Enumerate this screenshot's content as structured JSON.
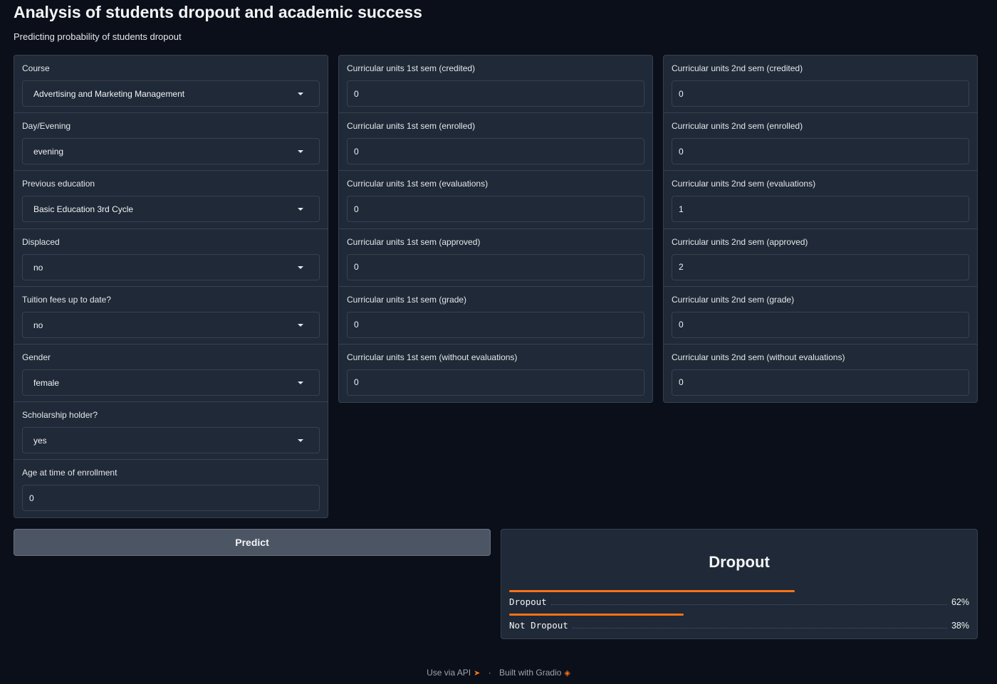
{
  "header": {
    "title": "Analysis of students dropout and academic success",
    "subtitle": "Predicting probability of students dropout"
  },
  "left_fields": [
    {
      "label": "Course",
      "value": "Advertising and Marketing Management",
      "kind": "dropdown"
    },
    {
      "label": "Day/Evening",
      "value": "evening",
      "kind": "dropdown"
    },
    {
      "label": "Previous education",
      "value": "Basic Education 3rd Cycle",
      "kind": "dropdown"
    },
    {
      "label": "Displaced",
      "value": "no",
      "kind": "dropdown"
    },
    {
      "label": "Tuition fees up to date?",
      "value": "no",
      "kind": "dropdown"
    },
    {
      "label": "Gender",
      "value": "female",
      "kind": "dropdown"
    },
    {
      "label": "Scholarship holder?",
      "value": "yes",
      "kind": "dropdown"
    },
    {
      "label": "Age at time of enrollment",
      "value": "0",
      "kind": "number"
    }
  ],
  "mid_fields": [
    {
      "label": "Curricular units 1st sem (credited)",
      "value": "0"
    },
    {
      "label": "Curricular units 1st sem (enrolled)",
      "value": "0"
    },
    {
      "label": "Curricular units 1st sem (evaluations)",
      "value": "0"
    },
    {
      "label": "Curricular units 1st sem (approved)",
      "value": "0"
    },
    {
      "label": "Curricular units 1st sem (grade)",
      "value": "0"
    },
    {
      "label": "Curricular units 1st sem (without evaluations)",
      "value": "0"
    }
  ],
  "right_fields": [
    {
      "label": "Curricular units 2nd sem (credited)",
      "value": "0"
    },
    {
      "label": "Curricular units 2nd sem (enrolled)",
      "value": "0"
    },
    {
      "label": "Curricular units 2nd sem (evaluations)",
      "value": "1"
    },
    {
      "label": "Curricular units 2nd sem (approved)",
      "value": "2"
    },
    {
      "label": "Curricular units 2nd sem (grade)",
      "value": "0"
    },
    {
      "label": "Curricular units 2nd sem (without evaluations)",
      "value": "0"
    }
  ],
  "predict_label": "Predict",
  "output": {
    "label": "Dropout",
    "confidences": [
      {
        "label": "Dropout",
        "pct": "62%",
        "value": 0.62
      },
      {
        "label": "Not Dropout",
        "pct": "38%",
        "value": 0.38
      }
    ]
  },
  "footer": {
    "api": "Use via API",
    "separator": "·",
    "built": "Built with Gradio"
  },
  "colors": {
    "accent": "#f97316",
    "background": "#0b0f19",
    "panel": "#1f2937"
  }
}
